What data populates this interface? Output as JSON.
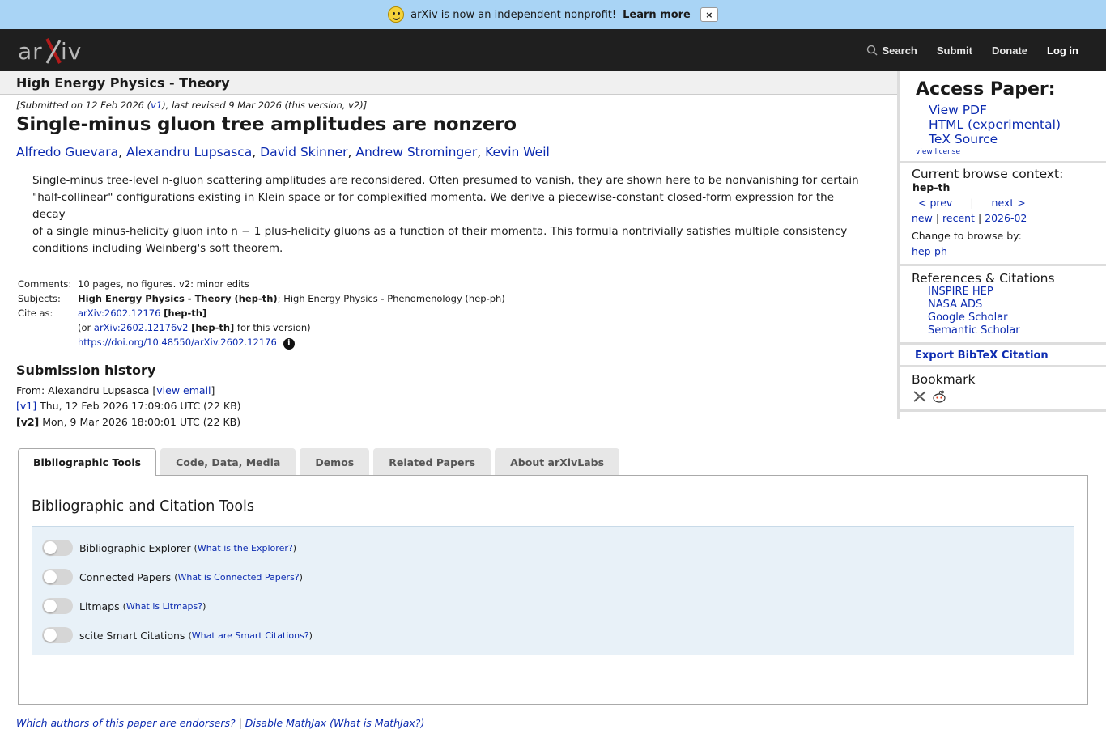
{
  "banner": {
    "message": "arXiv is now an independent nonprofit!",
    "learn_more": "Learn more",
    "close": "×"
  },
  "header": {
    "logo_text": "arXiv",
    "nav": {
      "search": "Search",
      "submit": "Submit",
      "donate": "Donate",
      "login": "Log in"
    }
  },
  "subject_bar": "High Energy Physics - Theory",
  "dateline": {
    "prefix": "[Submitted on 12 Feb 2026 (",
    "v1": "v1",
    "suffix": "), last revised 9 Mar 2026 (this version, v2)]"
  },
  "paper": {
    "title": "Single-minus gluon tree amplitudes are nonzero",
    "authors": [
      "Alfredo Guevara",
      "Alexandru Lupsasca",
      "David Skinner",
      "Andrew Strominger",
      "Kevin Weil"
    ],
    "abstract_lines": [
      "Single-minus tree-level n-gluon scattering amplitudes are reconsidered. Often presumed to vanish, they are shown here to be nonvanishing for certain",
      "\"half-collinear\" configurations existing in Klein space or for complexified momenta. We derive a piecewise-constant closed-form expression for the decay",
      "of a single minus-helicity gluon into n − 1 plus-helicity gluons as a function of their momenta. This formula nontrivially satisfies multiple consistency",
      "conditions including Weinberg's soft theorem."
    ]
  },
  "meta": {
    "comments_label": "Comments:",
    "comments": "10 pages, no figures. v2: minor edits",
    "subjects_label": "Subjects:",
    "subjects_primary": "High Energy Physics - Theory (hep-th)",
    "subjects_secondary": "; High Energy Physics - Phenomenology (hep-ph)",
    "cite_label": "Cite as:",
    "cite_id": "arXiv:2602.12176",
    "cite_cat": "[hep-th]",
    "or_prefix": "(or ",
    "cite_v2": "arXiv:2602.12176v2",
    "cite_v2_cat": "[hep-th]",
    "or_suffix": " for this version)",
    "doi": "https://doi.org/10.48550/arXiv.2602.12176",
    "info": "i"
  },
  "history": {
    "title": "Submission history",
    "from_prefix": "From: Alexandru Lupsasca [",
    "view_email": "view email",
    "from_suffix": "]",
    "v1_tag": "[v1]",
    "v1_text": " Thu, 12 Feb 2026 17:09:06 UTC (22 KB)",
    "v2_tag": "[v2]",
    "v2_text": " Mon, 9 Mar 2026 18:00:01 UTC (22 KB)"
  },
  "tabs": [
    "Bibliographic Tools",
    "Code, Data, Media",
    "Demos",
    "Related Papers",
    "About arXivLabs"
  ],
  "panel": {
    "title": "Bibliographic and Citation Tools",
    "toggles": [
      {
        "label": "Bibliographic Explorer",
        "help": "What is the Explorer?"
      },
      {
        "label": "Connected Papers",
        "help": "What is Connected Papers?"
      },
      {
        "label": "Litmaps",
        "help": "What is Litmaps?"
      },
      {
        "label": "scite Smart Citations",
        "help": "What are Smart Citations?"
      }
    ]
  },
  "footer": {
    "endorsers": "Which authors of this paper are endorsers?",
    "sep": " | ",
    "mathjax": "Disable MathJax",
    "what_mathjax": "(What is MathJax?)"
  },
  "sidebar": {
    "access_title": "Access Paper:",
    "access_links": [
      "View PDF",
      "HTML (experimental)",
      "TeX Source"
    ],
    "view_license": "view license",
    "context_title": "Current browse context:",
    "context": "hep-th",
    "prev": "< prev",
    "pipe": "|",
    "next": "next >",
    "new": "new",
    "recent": "recent",
    "month": "2026-02",
    "change_browse": "Change to browse by:",
    "browse_alt": "hep-ph",
    "refs_title": "References & Citations",
    "refs": [
      "INSPIRE HEP",
      "NASA ADS",
      "Google Scholar",
      "Semantic Scholar"
    ],
    "export": "Export BibTeX Citation",
    "bookmark": "Bookmark"
  },
  "colors": {
    "link": "#0c2bb0",
    "header_bg": "#1f1f1f",
    "banner_bg": "#a9d4f5",
    "logo_x": "#b31b1b"
  }
}
